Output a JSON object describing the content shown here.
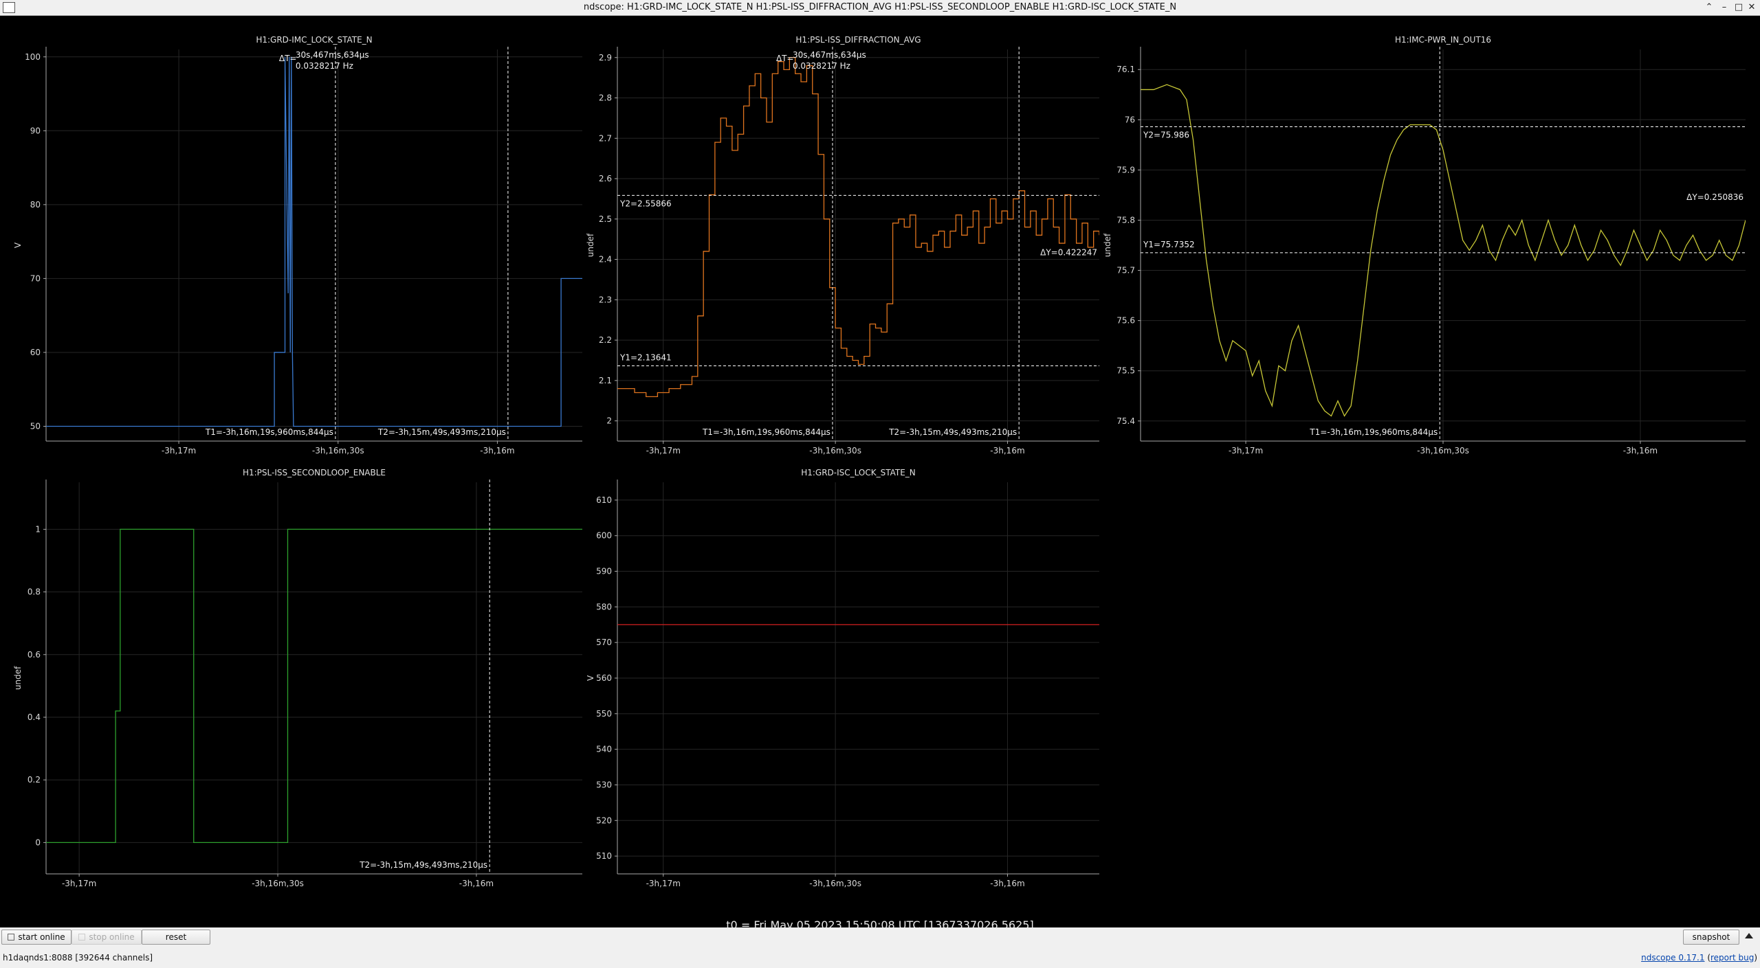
{
  "window": {
    "title": "ndscope: H1:GRD-IMC_LOCK_STATE_N H1:PSL-ISS_DIFFRACTION_AVG H1:PSL-ISS_SECONDLOOP_ENABLE H1:GRD-ISC_LOCK_STATE_N",
    "controls": [
      "⌃",
      "–",
      "□",
      "✕"
    ]
  },
  "t0_label": "t0 = Fri May 05 2023 15:50:08 UTC [1367337026.5625]",
  "toolbar": {
    "start_online": "start online",
    "stop_online": "stop online",
    "reset": "reset",
    "snapshot": "snapshot"
  },
  "status": {
    "server": "h1daqnds1:8088  [392644 channels]",
    "version_link": "ndscope 0.17.1",
    "report_open": " (",
    "report_bug": "report bug",
    "report_close": ")"
  },
  "colors": {
    "imc": "#3a7ad0",
    "diffraction": "#e0741e",
    "pwr": "#c8c836",
    "secondloop": "#2da02d",
    "isc": "#d42020",
    "cursor": "#ffffff"
  },
  "chart_data": [
    {
      "type": "line",
      "channel": "H1:GRD-IMC_LOCK_STATE_N",
      "title": "H1:GRD-IMC_LOCK_STATE_N",
      "ylabel": "V",
      "ylim": [
        48,
        101
      ],
      "yticks": [
        50,
        60,
        70,
        80,
        90,
        100
      ],
      "xlim": [
        -1045,
        -944
      ],
      "xticks": [
        -1020,
        -990,
        -960
      ],
      "xtick_labels": [
        "-3h,17m",
        "-3h,16m,30s",
        "-3h,16m"
      ],
      "x": [
        -1045,
        -1002,
        -1002,
        -1000,
        -1000,
        -999.4,
        -999.2,
        -999,
        -998.8,
        -998.6,
        -998.4,
        -980,
        -948,
        -948,
        -944
      ],
      "y": [
        50,
        50,
        60,
        60,
        100,
        68,
        100,
        60,
        100,
        60,
        50,
        50,
        50,
        70,
        70
      ],
      "cursors": {
        "T1": -990.5,
        "T2": -958
      },
      "annotations": {
        "T1": "T1=-3h,16m,19s,960ms,844µs",
        "T2": "T2=-3h,15m,49s,493ms,210µs",
        "dT_label": "ΔT=",
        "dT": "30s,467ms,634µs",
        "freq": "0.0328217 Hz"
      }
    },
    {
      "type": "line",
      "channel": "H1:PSL-ISS_DIFFRACTION_AVG",
      "title": "H1:PSL-ISS_DIFFRACTION_AVG",
      "ylabel": "undef",
      "ylim": [
        1.95,
        2.92
      ],
      "yticks": [
        2,
        2.1,
        2.2,
        2.3,
        2.4,
        2.5,
        2.6,
        2.7,
        2.8,
        2.9
      ],
      "xlim": [
        -1028,
        -944
      ],
      "xticks": [
        -1020,
        -990,
        -960
      ],
      "xtick_labels": [
        "-3h,17m",
        "-3h,16m,30s",
        "-3h,16m"
      ],
      "x": [
        -1028,
        -1025,
        -1023,
        -1021,
        -1019,
        -1017,
        -1015,
        -1014,
        -1013,
        -1012,
        -1011,
        -1010,
        -1009,
        -1008,
        -1007,
        -1006,
        -1005,
        -1004,
        -1003,
        -1002,
        -1001,
        -1000,
        -999,
        -998,
        -997,
        -996,
        -995,
        -994,
        -993,
        -992,
        -991,
        -990,
        -989,
        -988,
        -987,
        -986,
        -985,
        -984,
        -983,
        -982,
        -981,
        -980,
        -979,
        -978,
        -977,
        -976,
        -975,
        -974,
        -973,
        -972,
        -971,
        -970,
        -969,
        -968,
        -967,
        -966,
        -965,
        -964,
        -963,
        -962,
        -961,
        -960,
        -959,
        -958,
        -957,
        -956,
        -955,
        -954,
        -953,
        -952,
        -951,
        -950,
        -949,
        -948,
        -947,
        -946,
        -945,
        -944
      ],
      "y": [
        2.08,
        2.07,
        2.06,
        2.07,
        2.08,
        2.09,
        2.11,
        2.26,
        2.42,
        2.56,
        2.69,
        2.75,
        2.73,
        2.67,
        2.71,
        2.78,
        2.83,
        2.86,
        2.8,
        2.74,
        2.86,
        2.89,
        2.87,
        2.9,
        2.86,
        2.84,
        2.88,
        2.81,
        2.66,
        2.5,
        2.33,
        2.23,
        2.18,
        2.16,
        2.15,
        2.14,
        2.16,
        2.24,
        2.23,
        2.22,
        2.29,
        2.49,
        2.5,
        2.48,
        2.51,
        2.43,
        2.44,
        2.42,
        2.46,
        2.47,
        2.43,
        2.47,
        2.51,
        2.46,
        2.48,
        2.52,
        2.44,
        2.48,
        2.55,
        2.49,
        2.52,
        2.5,
        2.55,
        2.57,
        2.48,
        2.52,
        2.46,
        2.5,
        2.55,
        2.48,
        2.44,
        2.56,
        2.5,
        2.44,
        2.49,
        2.43,
        2.47,
        2.46
      ],
      "cursors": {
        "T1": -990.5,
        "T2": -958,
        "Y1": 2.13641,
        "Y2": 2.55866
      },
      "annotations": {
        "T1": "T1=-3h,16m,19s,960ms,844µs",
        "T2": "T2=-3h,15m,49s,493ms,210µs",
        "dT_label": "ΔT=",
        "dT": "30s,467ms,634µs",
        "freq": "0.0328217 Hz",
        "Y1": "Y1=2.13641",
        "Y2": "Y2=2.55866",
        "dY": "ΔY=0.422247"
      }
    },
    {
      "type": "line",
      "channel": "H1:IMC-PWR_IN_OUT16",
      "title": "H1:IMC-PWR_IN_OUT16",
      "ylabel": "undef",
      "ylim": [
        75.36,
        76.14
      ],
      "yticks": [
        75.4,
        75.5,
        75.6,
        75.7,
        75.8,
        75.9,
        76,
        76.1
      ],
      "xlim": [
        -1036,
        -944
      ],
      "xticks": [
        -1020,
        -990,
        -960
      ],
      "xtick_labels": [
        "-3h,17m",
        "-3h,16m,30s",
        "-3h,16m"
      ],
      "x": [
        -1036,
        -1034,
        -1032,
        -1030,
        -1029,
        -1028,
        -1027,
        -1026,
        -1025,
        -1024,
        -1023,
        -1022,
        -1021,
        -1020,
        -1019,
        -1018,
        -1017,
        -1016,
        -1015,
        -1014,
        -1013,
        -1012,
        -1011,
        -1010,
        -1009,
        -1008,
        -1007,
        -1006,
        -1005,
        -1004,
        -1003,
        -1002,
        -1001,
        -1000,
        -999,
        -998,
        -997,
        -996,
        -995,
        -994,
        -993,
        -992,
        -991,
        -990,
        -989,
        -988,
        -987,
        -986,
        -985,
        -984,
        -983,
        -982,
        -981,
        -980,
        -979,
        -978,
        -977,
        -976,
        -975,
        -974,
        -973,
        -972,
        -971,
        -970,
        -969,
        -968,
        -967,
        -966,
        -965,
        -964,
        -963,
        -962,
        -961,
        -960,
        -959,
        -958,
        -957,
        -956,
        -955,
        -954,
        -953,
        -952,
        -951,
        -950,
        -949,
        -948,
        -947,
        -946,
        -945,
        -944
      ],
      "y": [
        76.06,
        76.06,
        76.07,
        76.06,
        76.04,
        75.96,
        75.84,
        75.72,
        75.63,
        75.56,
        75.52,
        75.56,
        75.55,
        75.54,
        75.49,
        75.52,
        75.46,
        75.43,
        75.51,
        75.5,
        75.56,
        75.59,
        75.54,
        75.49,
        75.44,
        75.42,
        75.41,
        75.44,
        75.41,
        75.43,
        75.52,
        75.63,
        75.74,
        75.82,
        75.88,
        75.93,
        75.96,
        75.98,
        75.99,
        75.99,
        75.99,
        75.99,
        75.98,
        75.94,
        75.88,
        75.82,
        75.76,
        75.74,
        75.76,
        75.79,
        75.74,
        75.72,
        75.76,
        75.79,
        75.77,
        75.8,
        75.75,
        75.72,
        75.76,
        75.8,
        75.76,
        75.73,
        75.75,
        75.79,
        75.75,
        75.72,
        75.74,
        75.78,
        75.76,
        75.73,
        75.71,
        75.74,
        75.78,
        75.75,
        75.72,
        75.74,
        75.78,
        75.76,
        75.73,
        75.72,
        75.75,
        75.77,
        75.74,
        75.72,
        75.73,
        75.76,
        75.73,
        75.72,
        75.75,
        75.8
      ],
      "cursors": {
        "T1": -990.5,
        "Y1": 75.7352,
        "Y2": 75.986
      },
      "annotations": {
        "T1": "T1=-3h,16m,19s,960ms,844µs",
        "Y1": "Y1=75.7352",
        "Y2": "Y2=75.986",
        "dY": "ΔY=0.250836"
      }
    },
    {
      "type": "line",
      "channel": "H1:PSL-ISS_SECONDLOOP_ENABLE",
      "title": "H1:PSL-ISS_SECONDLOOP_ENABLE",
      "ylabel": "undef",
      "ylim": [
        -0.1,
        1.15
      ],
      "yticks": [
        0,
        0.2,
        0.4,
        0.6,
        0.8,
        1
      ],
      "xtick_labels_num": [
        0,
        0.2,
        0.4,
        0.6,
        0.8,
        1
      ],
      "xlim": [
        -1025,
        -944
      ],
      "xticks": [
        -1020,
        -990,
        -960
      ],
      "xtick_labels": [
        "-3h,17m",
        "-3h,16m,30s",
        "-3h,16m"
      ],
      "x": [
        -1025,
        -1014.5,
        -1014.5,
        -1013.8,
        -1013.8,
        -1002.7,
        -1002.7,
        -988.5,
        -988.5,
        -944
      ],
      "y": [
        0,
        0,
        0.42,
        0.42,
        1,
        1,
        0,
        0,
        1,
        1
      ],
      "cursors": {
        "T2": -958
      },
      "annotations": {
        "T2": "T2=-3h,15m,49s,493ms,210µs"
      }
    },
    {
      "type": "line",
      "channel": "H1:GRD-ISC_LOCK_STATE_N",
      "title": "H1:GRD-ISC_LOCK_STATE_N",
      "ylabel": "V",
      "ylim": [
        505,
        615
      ],
      "yticks": [
        510,
        520,
        530,
        540,
        550,
        560,
        570,
        580,
        590,
        600,
        610
      ],
      "xlim": [
        -1028,
        -944
      ],
      "xticks": [
        -1020,
        -990,
        -960
      ],
      "xtick_labels": [
        "-3h,17m",
        "-3h,16m,30s",
        "-3h,16m"
      ],
      "x": [
        -1028,
        -944
      ],
      "y": [
        575,
        575
      ]
    }
  ]
}
